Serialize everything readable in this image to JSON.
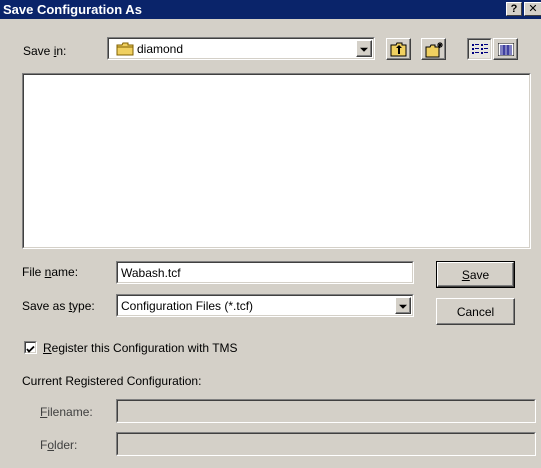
{
  "window": {
    "title": "Save Configuration As",
    "help_glyph": "?",
    "close_glyph": "✕"
  },
  "save_in": {
    "label_pre": "Save ",
    "label_accel": "i",
    "label_post": "n:",
    "folder": "diamond",
    "folder_icon": "folder-icon"
  },
  "toolbar": {
    "up_icon": "up-folder-icon",
    "new_folder_icon": "new-folder-icon",
    "list_icon": "list-view-icon",
    "details_icon": "details-view-icon"
  },
  "file_name": {
    "label_pre": "File ",
    "label_accel": "n",
    "label_post": "ame:",
    "value": "Wabash.tcf"
  },
  "save_type": {
    "label_pre": "Save as ",
    "label_accel": "t",
    "label_post": "ype:",
    "value": "Configuration Files (*.tcf)"
  },
  "buttons": {
    "save_accel": "S",
    "save_rest": "ave",
    "cancel": "Cancel"
  },
  "register": {
    "checked": true,
    "label_accel": "R",
    "label_rest": "egister this Configuration with TMS"
  },
  "current": {
    "heading": "Current Registered Configuration:",
    "filename_accel": "F",
    "filename_rest": "ilename:",
    "folder_pre": "F",
    "folder_accel": "o",
    "folder_post": "lder:",
    "filename_value": "",
    "folder_value": ""
  }
}
